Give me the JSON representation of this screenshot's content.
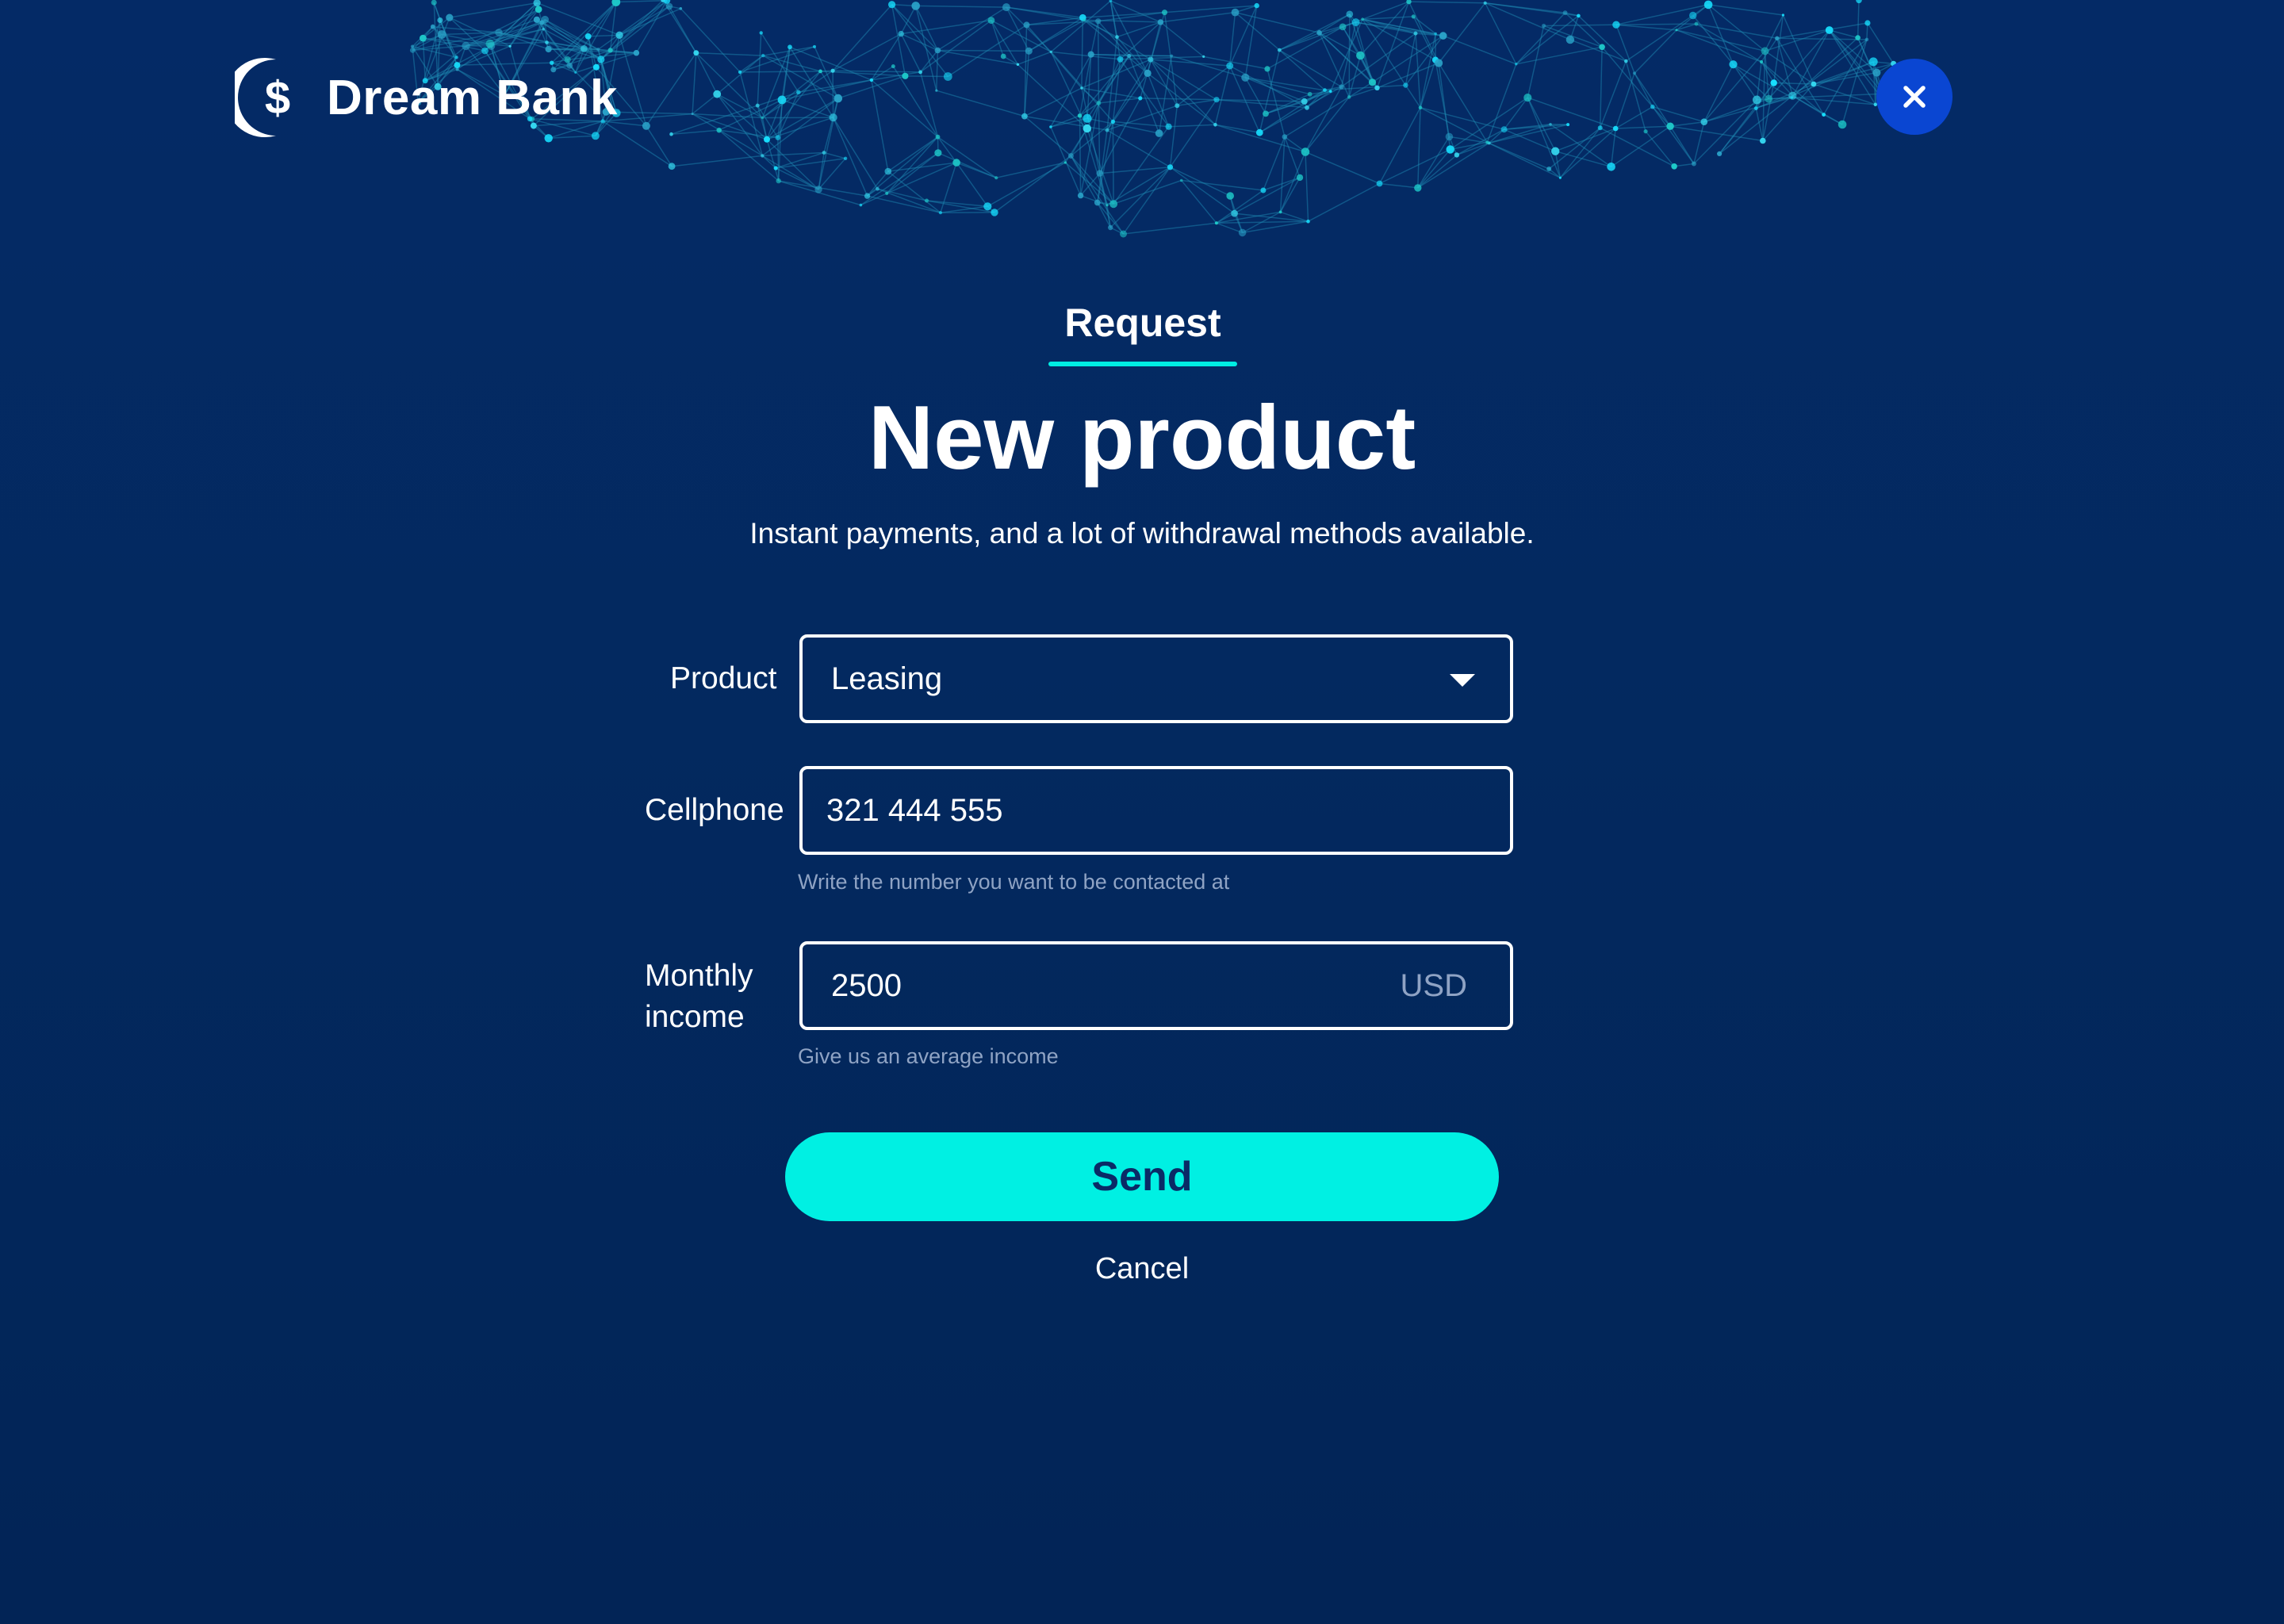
{
  "brand": {
    "name": "Dream Bank",
    "logo_icon": "dollar-crescent-logo"
  },
  "close": {
    "icon": "close-icon"
  },
  "tab": {
    "label": "Request"
  },
  "heading": {
    "title": "New product",
    "subtitle": "Instant payments, and a lot of withdrawal methods available."
  },
  "form": {
    "product": {
      "label": "Product",
      "value": "Leasing"
    },
    "cellphone": {
      "label": "Cellphone",
      "value": "321 444 555",
      "helper": "Write the number you want to be contacted at"
    },
    "income": {
      "label_line1": "Monthly",
      "label_line2": "income",
      "value": "2500",
      "currency": "USD",
      "helper": "Give us an average income"
    }
  },
  "actions": {
    "send_label": "Send",
    "cancel_label": "Cancel"
  },
  "colors": {
    "background": "#03295f",
    "accent": "#00f0e3",
    "close_button": "#0a46d2",
    "helper_text": "#8fa3c4"
  }
}
